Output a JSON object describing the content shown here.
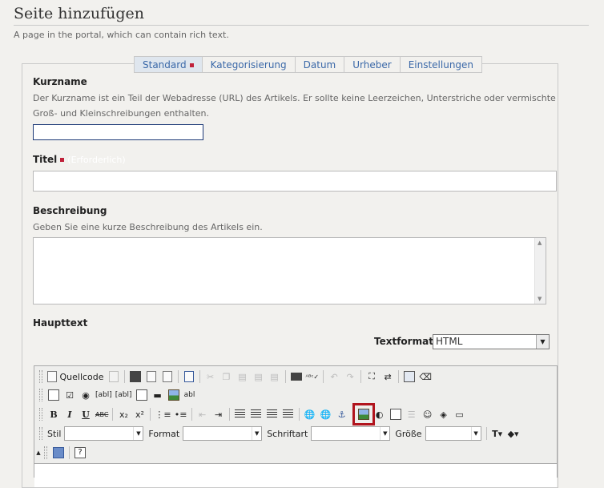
{
  "header": {
    "title": "Seite hinzufügen",
    "subtitle": "A page in the portal, which can contain rich text."
  },
  "tabs": [
    {
      "label": "Standard",
      "required": true
    },
    {
      "label": "Kategorisierung"
    },
    {
      "label": "Datum"
    },
    {
      "label": "Urheber"
    },
    {
      "label": "Einstellungen"
    }
  ],
  "fields": {
    "kurzname": {
      "label": "Kurzname",
      "help_line1": "Der Kurzname ist ein Teil der Webadresse (URL) des Artikels. Er sollte keine Leerzeichen, Unterstriche oder vermischte",
      "help_line2": "Groß- und Kleinschreibungen enthalten.",
      "value": ""
    },
    "titel": {
      "label": "Titel",
      "required_text": "(Erforderlich)",
      "value": ""
    },
    "beschreibung": {
      "label": "Beschreibung",
      "help": "Geben Sie eine kurze Beschreibung des Artikels ein.",
      "value": ""
    },
    "haupttext": {
      "label": "Haupttext",
      "textformat_label": "Textformat",
      "textformat_value": "HTML"
    }
  },
  "editor": {
    "toolbar1": {
      "quellcode_label": "Quellcode"
    },
    "toolbar4": {
      "stil_label": "Stil",
      "format_label": "Format",
      "schriftart_label": "Schriftart",
      "groesse_label": "Größe"
    },
    "bold": "B",
    "italic": "I",
    "underline": "U",
    "strike": "ABC"
  },
  "colors": {
    "accent_link": "#3a68a8",
    "required": "#c0213a",
    "highlight": "#b1141d"
  }
}
